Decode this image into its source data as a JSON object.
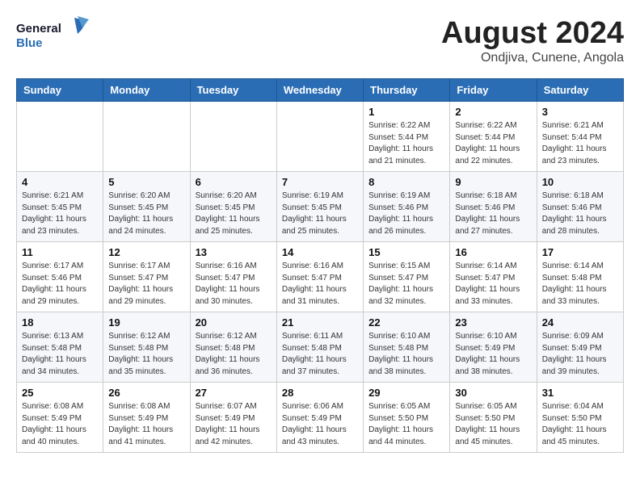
{
  "logo": {
    "line1": "General",
    "line2": "Blue"
  },
  "title": "August 2024",
  "subtitle": "Ondjiva, Cunene, Angola",
  "days_of_week": [
    "Sunday",
    "Monday",
    "Tuesday",
    "Wednesday",
    "Thursday",
    "Friday",
    "Saturday"
  ],
  "weeks": [
    [
      {
        "day": "",
        "info": ""
      },
      {
        "day": "",
        "info": ""
      },
      {
        "day": "",
        "info": ""
      },
      {
        "day": "",
        "info": ""
      },
      {
        "day": "1",
        "info": "Sunrise: 6:22 AM\nSunset: 5:44 PM\nDaylight: 11 hours\nand 21 minutes."
      },
      {
        "day": "2",
        "info": "Sunrise: 6:22 AM\nSunset: 5:44 PM\nDaylight: 11 hours\nand 22 minutes."
      },
      {
        "day": "3",
        "info": "Sunrise: 6:21 AM\nSunset: 5:44 PM\nDaylight: 11 hours\nand 23 minutes."
      }
    ],
    [
      {
        "day": "4",
        "info": "Sunrise: 6:21 AM\nSunset: 5:45 PM\nDaylight: 11 hours\nand 23 minutes."
      },
      {
        "day": "5",
        "info": "Sunrise: 6:20 AM\nSunset: 5:45 PM\nDaylight: 11 hours\nand 24 minutes."
      },
      {
        "day": "6",
        "info": "Sunrise: 6:20 AM\nSunset: 5:45 PM\nDaylight: 11 hours\nand 25 minutes."
      },
      {
        "day": "7",
        "info": "Sunrise: 6:19 AM\nSunset: 5:45 PM\nDaylight: 11 hours\nand 25 minutes."
      },
      {
        "day": "8",
        "info": "Sunrise: 6:19 AM\nSunset: 5:46 PM\nDaylight: 11 hours\nand 26 minutes."
      },
      {
        "day": "9",
        "info": "Sunrise: 6:18 AM\nSunset: 5:46 PM\nDaylight: 11 hours\nand 27 minutes."
      },
      {
        "day": "10",
        "info": "Sunrise: 6:18 AM\nSunset: 5:46 PM\nDaylight: 11 hours\nand 28 minutes."
      }
    ],
    [
      {
        "day": "11",
        "info": "Sunrise: 6:17 AM\nSunset: 5:46 PM\nDaylight: 11 hours\nand 29 minutes."
      },
      {
        "day": "12",
        "info": "Sunrise: 6:17 AM\nSunset: 5:47 PM\nDaylight: 11 hours\nand 29 minutes."
      },
      {
        "day": "13",
        "info": "Sunrise: 6:16 AM\nSunset: 5:47 PM\nDaylight: 11 hours\nand 30 minutes."
      },
      {
        "day": "14",
        "info": "Sunrise: 6:16 AM\nSunset: 5:47 PM\nDaylight: 11 hours\nand 31 minutes."
      },
      {
        "day": "15",
        "info": "Sunrise: 6:15 AM\nSunset: 5:47 PM\nDaylight: 11 hours\nand 32 minutes."
      },
      {
        "day": "16",
        "info": "Sunrise: 6:14 AM\nSunset: 5:47 PM\nDaylight: 11 hours\nand 33 minutes."
      },
      {
        "day": "17",
        "info": "Sunrise: 6:14 AM\nSunset: 5:48 PM\nDaylight: 11 hours\nand 33 minutes."
      }
    ],
    [
      {
        "day": "18",
        "info": "Sunrise: 6:13 AM\nSunset: 5:48 PM\nDaylight: 11 hours\nand 34 minutes."
      },
      {
        "day": "19",
        "info": "Sunrise: 6:12 AM\nSunset: 5:48 PM\nDaylight: 11 hours\nand 35 minutes."
      },
      {
        "day": "20",
        "info": "Sunrise: 6:12 AM\nSunset: 5:48 PM\nDaylight: 11 hours\nand 36 minutes."
      },
      {
        "day": "21",
        "info": "Sunrise: 6:11 AM\nSunset: 5:48 PM\nDaylight: 11 hours\nand 37 minutes."
      },
      {
        "day": "22",
        "info": "Sunrise: 6:10 AM\nSunset: 5:48 PM\nDaylight: 11 hours\nand 38 minutes."
      },
      {
        "day": "23",
        "info": "Sunrise: 6:10 AM\nSunset: 5:49 PM\nDaylight: 11 hours\nand 38 minutes."
      },
      {
        "day": "24",
        "info": "Sunrise: 6:09 AM\nSunset: 5:49 PM\nDaylight: 11 hours\nand 39 minutes."
      }
    ],
    [
      {
        "day": "25",
        "info": "Sunrise: 6:08 AM\nSunset: 5:49 PM\nDaylight: 11 hours\nand 40 minutes."
      },
      {
        "day": "26",
        "info": "Sunrise: 6:08 AM\nSunset: 5:49 PM\nDaylight: 11 hours\nand 41 minutes."
      },
      {
        "day": "27",
        "info": "Sunrise: 6:07 AM\nSunset: 5:49 PM\nDaylight: 11 hours\nand 42 minutes."
      },
      {
        "day": "28",
        "info": "Sunrise: 6:06 AM\nSunset: 5:49 PM\nDaylight: 11 hours\nand 43 minutes."
      },
      {
        "day": "29",
        "info": "Sunrise: 6:05 AM\nSunset: 5:50 PM\nDaylight: 11 hours\nand 44 minutes."
      },
      {
        "day": "30",
        "info": "Sunrise: 6:05 AM\nSunset: 5:50 PM\nDaylight: 11 hours\nand 45 minutes."
      },
      {
        "day": "31",
        "info": "Sunrise: 6:04 AM\nSunset: 5:50 PM\nDaylight: 11 hours\nand 45 minutes."
      }
    ]
  ]
}
